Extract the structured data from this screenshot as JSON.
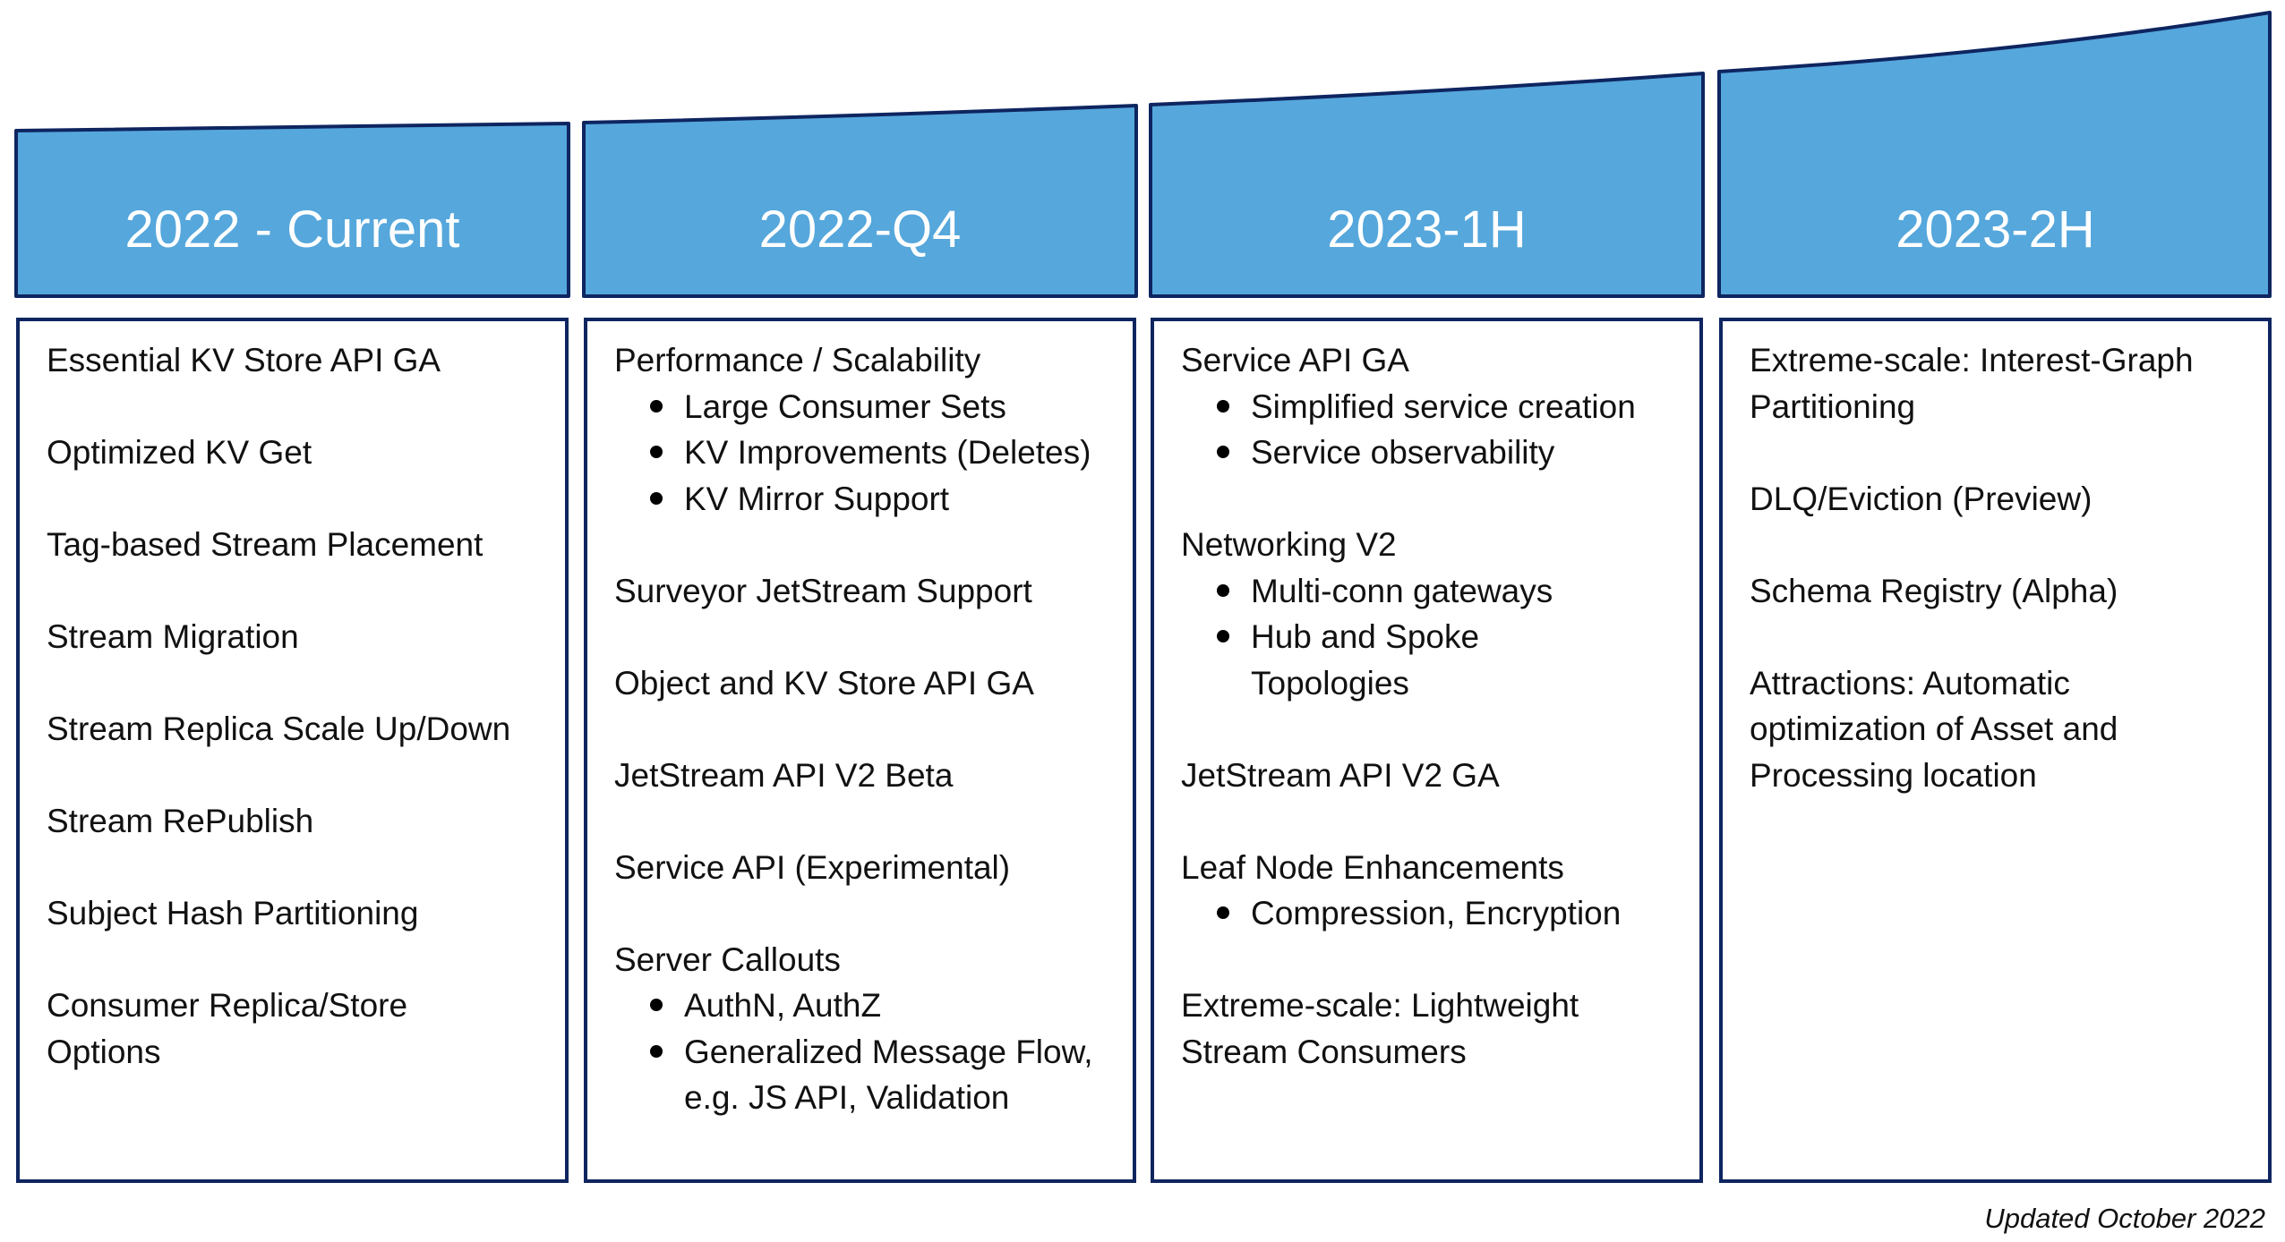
{
  "theme": {
    "header_fill": "#55A7DC",
    "header_border": "#0E2560",
    "box_border": "#0E2560",
    "header_text": "#FFFFFF"
  },
  "phases": [
    {
      "title": "2022 - Current",
      "entries": [
        {
          "lines": [
            "Essential KV Store API GA"
          ],
          "bullets": []
        },
        {
          "lines": [
            "Optimized KV Get"
          ],
          "bullets": []
        },
        {
          "lines": [
            "Tag-based Stream Placement"
          ],
          "bullets": []
        },
        {
          "lines": [
            "Stream Migration"
          ],
          "bullets": []
        },
        {
          "lines": [
            "Stream Replica Scale Up/Down"
          ],
          "bullets": []
        },
        {
          "lines": [
            "Stream RePublish"
          ],
          "bullets": []
        },
        {
          "lines": [
            "Subject Hash Partitioning"
          ],
          "bullets": []
        },
        {
          "lines": [
            "Consumer Replica/Store",
            "Options"
          ],
          "bullets": []
        }
      ]
    },
    {
      "title": "2022-Q4",
      "entries": [
        {
          "lines": [
            "Performance / Scalability"
          ],
          "bullets": [
            {
              "lines": [
                "Large Consumer Sets"
              ]
            },
            {
              "lines": [
                "KV Improvements (Deletes)"
              ]
            },
            {
              "lines": [
                "KV Mirror Support"
              ]
            }
          ]
        },
        {
          "lines": [
            "Surveyor JetStream Support"
          ],
          "bullets": []
        },
        {
          "lines": [
            "Object and KV Store  API GA"
          ],
          "bullets": []
        },
        {
          "lines": [
            "JetStream API V2 Beta"
          ],
          "bullets": []
        },
        {
          "lines": [
            "Service API (Experimental)"
          ],
          "bullets": []
        },
        {
          "lines": [
            "Server Callouts"
          ],
          "bullets": [
            {
              "lines": [
                "AuthN, AuthZ"
              ]
            },
            {
              "lines": [
                "Generalized Message Flow,",
                "e.g. JS API, Validation"
              ]
            }
          ]
        }
      ]
    },
    {
      "title": "2023-1H",
      "entries": [
        {
          "lines": [
            "Service API GA"
          ],
          "bullets": [
            {
              "lines": [
                "Simplified service creation"
              ]
            },
            {
              "lines": [
                "Service observability"
              ]
            }
          ]
        },
        {
          "lines": [
            "Networking V2"
          ],
          "bullets": [
            {
              "lines": [
                "Multi-conn gateways"
              ]
            },
            {
              "lines": [
                "Hub and Spoke",
                "Topologies"
              ]
            }
          ]
        },
        {
          "lines": [
            "JetStream API V2 GA"
          ],
          "bullets": []
        },
        {
          "lines": [
            "Leaf Node Enhancements"
          ],
          "bullets": [
            {
              "lines": [
                "Compression, Encryption"
              ]
            }
          ]
        },
        {
          "lines": [
            "Extreme-scale: Lightweight",
            "Stream Consumers"
          ],
          "bullets": []
        }
      ]
    },
    {
      "title": "2023-2H",
      "entries": [
        {
          "lines": [
            "Extreme-scale: Interest-Graph",
            "Partitioning"
          ],
          "bullets": []
        },
        {
          "lines": [
            "DLQ/Eviction (Preview)"
          ],
          "bullets": []
        },
        {
          "lines": [
            "Schema Registry (Alpha)"
          ],
          "bullets": []
        },
        {
          "lines": [
            "Attractions: Automatic",
            "optimization of Asset and",
            "Processing location"
          ],
          "bullets": []
        }
      ]
    }
  ],
  "footer": {
    "note": "Updated October  2022"
  }
}
